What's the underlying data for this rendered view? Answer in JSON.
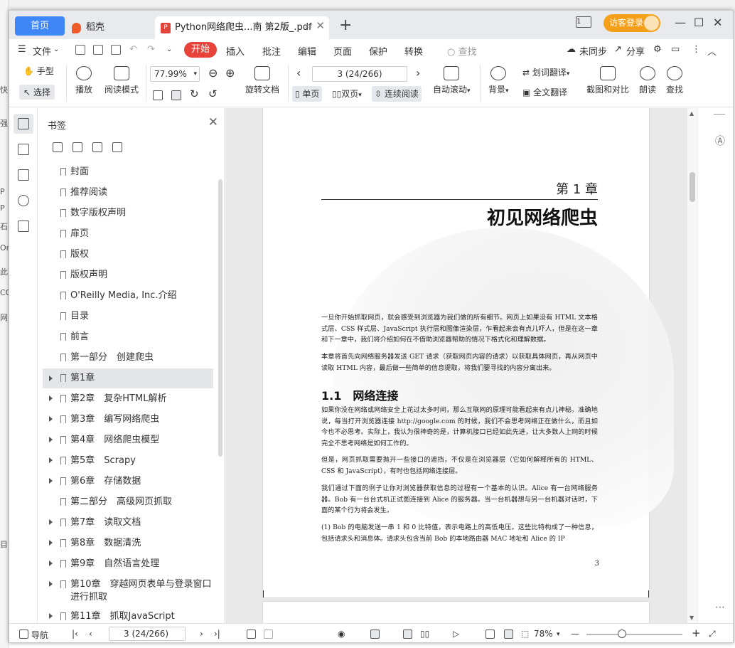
{
  "bg": {
    "left_texts": [
      "快",
      "强",
      "P",
      "P",
      "石",
      "Or",
      "此",
      "CO",
      "网",
      "目"
    ]
  },
  "titlebar": {
    "tab_home": "首页",
    "tab_daoke": "稻壳",
    "tab_pdf": "Python网络爬虫...南 第2版_.pdf",
    "tab_pdf_icon": "P",
    "page_count_icon": "1",
    "login": "访客登录"
  },
  "menu": {
    "file": "文件",
    "start": "开始",
    "items": [
      "插入",
      "批注",
      "编辑",
      "页面",
      "保护",
      "转换"
    ],
    "search": "查找",
    "sync": "未同步",
    "share": "分享"
  },
  "toolbar": {
    "hand": "手型",
    "select": "选择",
    "play": "播放",
    "read_mode": "阅读模式",
    "zoom_value": "77.99%",
    "rotate_doc": "旋转文档",
    "page_value": "3 (24/266)",
    "single": "单页",
    "double": "双页",
    "continuous": "连续阅读",
    "auto_scroll": "自动滚动",
    "background": "背景",
    "word_translate": "划词翻译",
    "full_translate": "全文翻译",
    "screenshot_compare": "截图和对比",
    "read_aloud": "朗读",
    "find": "查找"
  },
  "bookmarks": {
    "title": "书签",
    "items": [
      {
        "label": "封面",
        "expandable": false
      },
      {
        "label": "推荐阅读",
        "expandable": false
      },
      {
        "label": "数字版权声明",
        "expandable": false
      },
      {
        "label": "扉页",
        "expandable": false
      },
      {
        "label": "版权",
        "expandable": false
      },
      {
        "label": "版权声明",
        "expandable": false
      },
      {
        "label": "O'Reilly Media, Inc.介绍",
        "expandable": false
      },
      {
        "label": "目录",
        "expandable": false
      },
      {
        "label": "前言",
        "expandable": false
      },
      {
        "label": "第一部分　创建爬虫",
        "expandable": false
      },
      {
        "label": "第1章",
        "expandable": true,
        "active": true
      },
      {
        "label": "第2章　复杂HTML解析",
        "expandable": true
      },
      {
        "label": "第3章　编写网络爬虫",
        "expandable": true
      },
      {
        "label": "第4章　网络爬虫模型",
        "expandable": true
      },
      {
        "label": "第5章　Scrapy",
        "expandable": true
      },
      {
        "label": "第6章　存储数据",
        "expandable": true
      },
      {
        "label": "第二部分　高级网页抓取",
        "expandable": false
      },
      {
        "label": "第7章　读取文档",
        "expandable": true
      },
      {
        "label": "第8章　数据清洗",
        "expandable": true
      },
      {
        "label": "第9章　自然语言处理",
        "expandable": true
      },
      {
        "label": "第10章　穿越网页表单与登录窗口进行抓取",
        "expandable": true
      },
      {
        "label": "第11章　抓取JavaScript",
        "expandable": true
      }
    ]
  },
  "page": {
    "chapter_num": "第 1 章",
    "chapter_title": "初见网络爬虫",
    "para1": "一旦你开始抓取网页，就会感受到浏览器为我们做的所有细节。网页上如果没有 HTML 文本格式层、CSS 样式层、JavaScript 执行层和图像渲染层，乍看起来会有点儿吓人，但是在这一章和下一章中，我们将介绍如何在不借助浏览器帮助的情况下格式化和理解数据。",
    "para2": "本章将首先向网络服务器发送 GET 请求（获取网页内容的请求）以获取具体网页，再从网页中读取 HTML 内容，最后做一些简单的信息提取，将我们要寻找的内容分离出来。",
    "section_title": "1.1　网络连接",
    "para3": "如果你没在网络或网络安全上花过太多时间，那么互联网的原理可能看起来有点儿神秘。准确地说，每当打开浏览器连接 http://google.com 的时候，我们不会思考网络正在做什么，而且如今也不必思考。实际上，我认为很神奇的是，计算机接口已经如此先进，让大多数人上网的时候完全不思考网络是如何工作的。",
    "para4": "但是，网页抓取需要抛开一些接口的遮挡，不仅是在浏览器层（它如何解释所有的 HTML、CSS 和 JavaScript），有时也包括网络连接层。",
    "para5": "我们通过下面的例子让你对浏览器获取信息的过程有一个基本的认识。Alice 有一台网络服务器。Bob 有一台台式机正试图连接到 Alice 的服务器。当一台机器想与另一台机器对话时，下面的某个行为将会发生。",
    "para6": "(1) Bob 的电脑发送一串 1 和 0 比特值，表示电路上的高低电压。这些比特构成了一种信息，包括请求头和消息体。请求头包含当前 Bob 的本地路由器 MAC 地址和 Alice 的 IP",
    "page_number": "3"
  },
  "statusbar": {
    "nav": "导航",
    "page_value": "3 (24/266)",
    "zoom": "78%"
  }
}
